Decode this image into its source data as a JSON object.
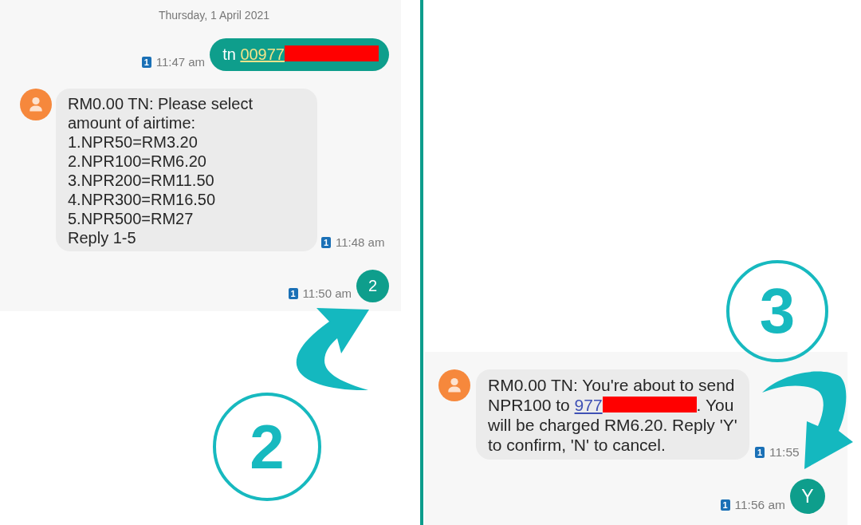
{
  "panels": [
    {
      "date": "Thursday, 1 April 2021",
      "messages": [
        {
          "kind": "outgoing",
          "sim": "1",
          "time": "11:47 am",
          "text": "tn ",
          "link": "00977",
          "redacted": true
        },
        {
          "kind": "incoming",
          "text": "RM0.00 TN: Please select\namount of airtime:\n1.NPR50=RM3.20\n2.NPR100=RM6.20\n3.NPR200=RM11.50\n4.NPR300=RM16.50\n5.NPR500=RM27\nReply 1-5",
          "sim": "1",
          "time": "11:48 am"
        },
        {
          "kind": "outgoing",
          "sim": "1",
          "time": "11:50 am",
          "text": "2"
        }
      ],
      "step": "2"
    },
    {
      "step": "3",
      "messages": [
        {
          "kind": "incoming",
          "text": "RM0.00 TN: You're about to send NPR100 to ",
          "link": "977",
          "redacted": true,
          "text_after": ". You will be charged RM6.20. Reply 'Y' to confirm, 'N' to cancel.",
          "sim": "1",
          "time": "11:55"
        },
        {
          "kind": "outgoing",
          "sim": "1",
          "time": "11:56 am",
          "text": "Y"
        }
      ]
    }
  ]
}
